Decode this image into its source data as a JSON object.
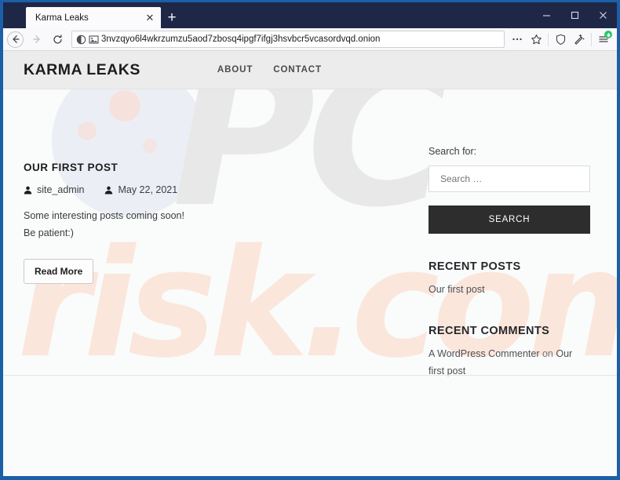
{
  "browser": {
    "tab": {
      "title": "Karma Leaks",
      "close_label": "✕"
    },
    "newtab_label": "+",
    "window_controls": {
      "minimize": "minimize-button",
      "maximize": "maximize-button",
      "close": "close-button"
    },
    "toolbar": {
      "back": "back-button",
      "forward": "forward-button",
      "reload": "reload-button",
      "url": "3nvzqyo6l4wkrzumzu5aod7zbosq4ipgf7ifgj3hsvbcr5vcasordvqd.onion",
      "page_actions": "…",
      "bookmark": "bookmark-star-icon",
      "shield": "tracking-protection-icon",
      "new_identity": "new-identity-icon",
      "menu": "application-menu-icon"
    },
    "titlebar_color": "#1f2747",
    "frame_color": "#1b5fa8"
  },
  "site": {
    "brand": "Karma Leaks",
    "nav": [
      {
        "label": "About"
      },
      {
        "label": "Contact"
      }
    ],
    "header_bg": "#ececec"
  },
  "post": {
    "title": "Our first post",
    "author": "site_admin",
    "date": "May 22, 2021",
    "excerpt_line1": "Some interesting posts coming soon!",
    "excerpt_line2": "Be patient:)",
    "read_more": "Read More"
  },
  "sidebar": {
    "search": {
      "label": "Search for:",
      "placeholder": "Search …",
      "value": "",
      "button": "Search",
      "button_color": "#2d2d2d"
    },
    "recent_posts": {
      "title": "Recent Posts",
      "items": [
        {
          "label": "Our first post"
        }
      ]
    },
    "recent_comments": {
      "title": "Recent Comments",
      "items": [
        {
          "author": "A WordPress Commenter",
          "connector": "on",
          "post": "Our first post"
        }
      ]
    }
  },
  "watermark": {
    "primary": "PC",
    "secondary": "risk.com",
    "primary_color": "#e8e8e8",
    "secondary_color": "#fbe6db"
  }
}
